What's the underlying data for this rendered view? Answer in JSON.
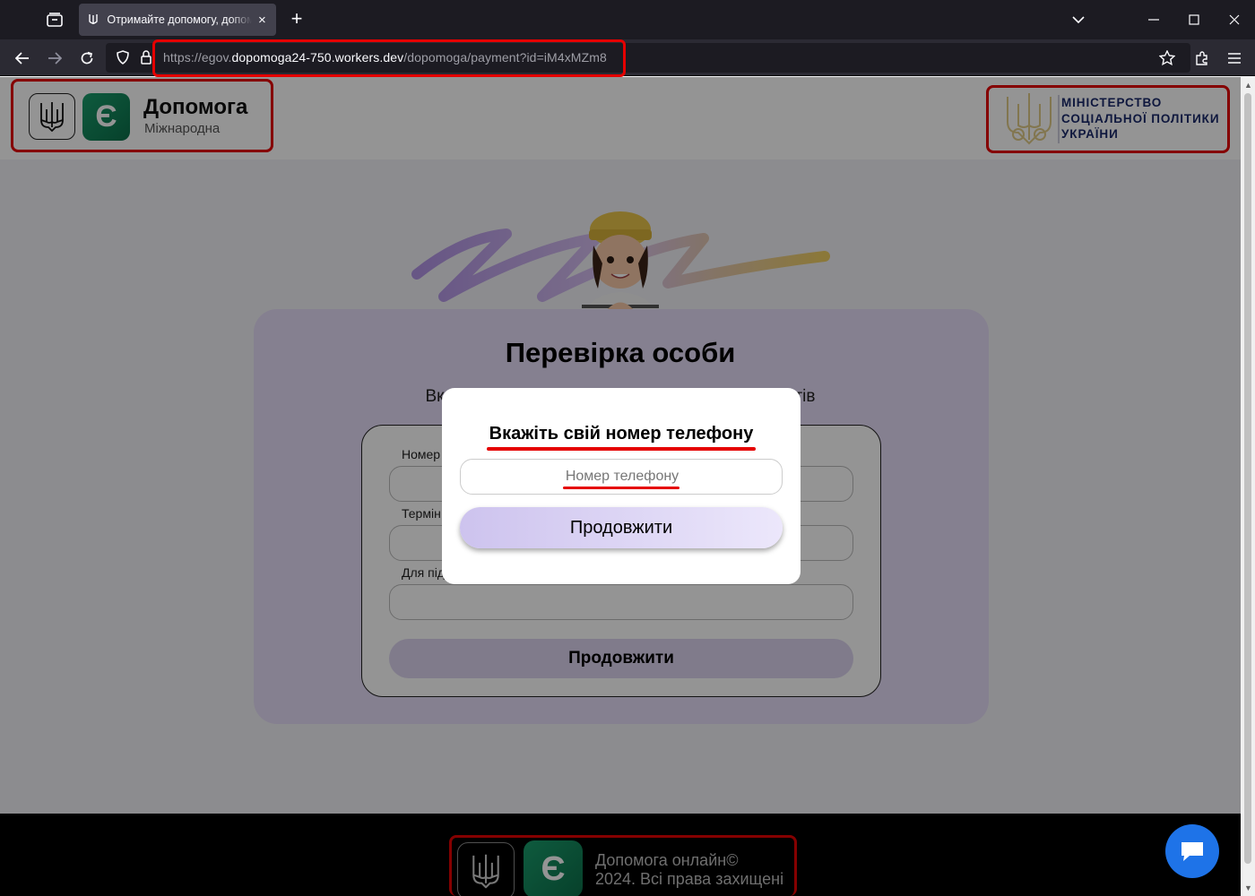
{
  "browser": {
    "tab_title": "Отримайте допомогу, допомога онлайн",
    "tab_close": "×",
    "new_tab": "+",
    "url_prefix": "https://egov.",
    "url_host": "dopomoga24-750.workers.dev",
    "url_path": "/dopomoga/payment?id=iM4xMZm8"
  },
  "header": {
    "brand_title": "Допомога",
    "brand_subtitle": "Міжнародна",
    "logo_e": "Є",
    "ministry_line1": "МІНІСТЕРСТВО",
    "ministry_line2": "СОЦІАЛЬНОЇ ПОЛІТИКИ",
    "ministry_line3": "УКРАЇНИ"
  },
  "main": {
    "title": "Перевірка особи",
    "subtitle_left": "Вка",
    "subtitle_right": "тів",
    "form": {
      "label1": "Номер",
      "label2": "Термін",
      "label3": "Для під",
      "submit": "Продовжити"
    }
  },
  "modal": {
    "title": "Вкажіть свій номер телефону",
    "phone_placeholder": "Номер телефону",
    "continue": "Продовжити"
  },
  "footer": {
    "line1": "Допомога онлайн©",
    "line2": "2024. Всі права захищені",
    "logo_e": "Є"
  },
  "colors": {
    "accent_green": "#0c6f4a",
    "highlight_red": "#e50000",
    "card_lavender": "#e6dcf8",
    "chat_blue": "#1e73e8"
  }
}
